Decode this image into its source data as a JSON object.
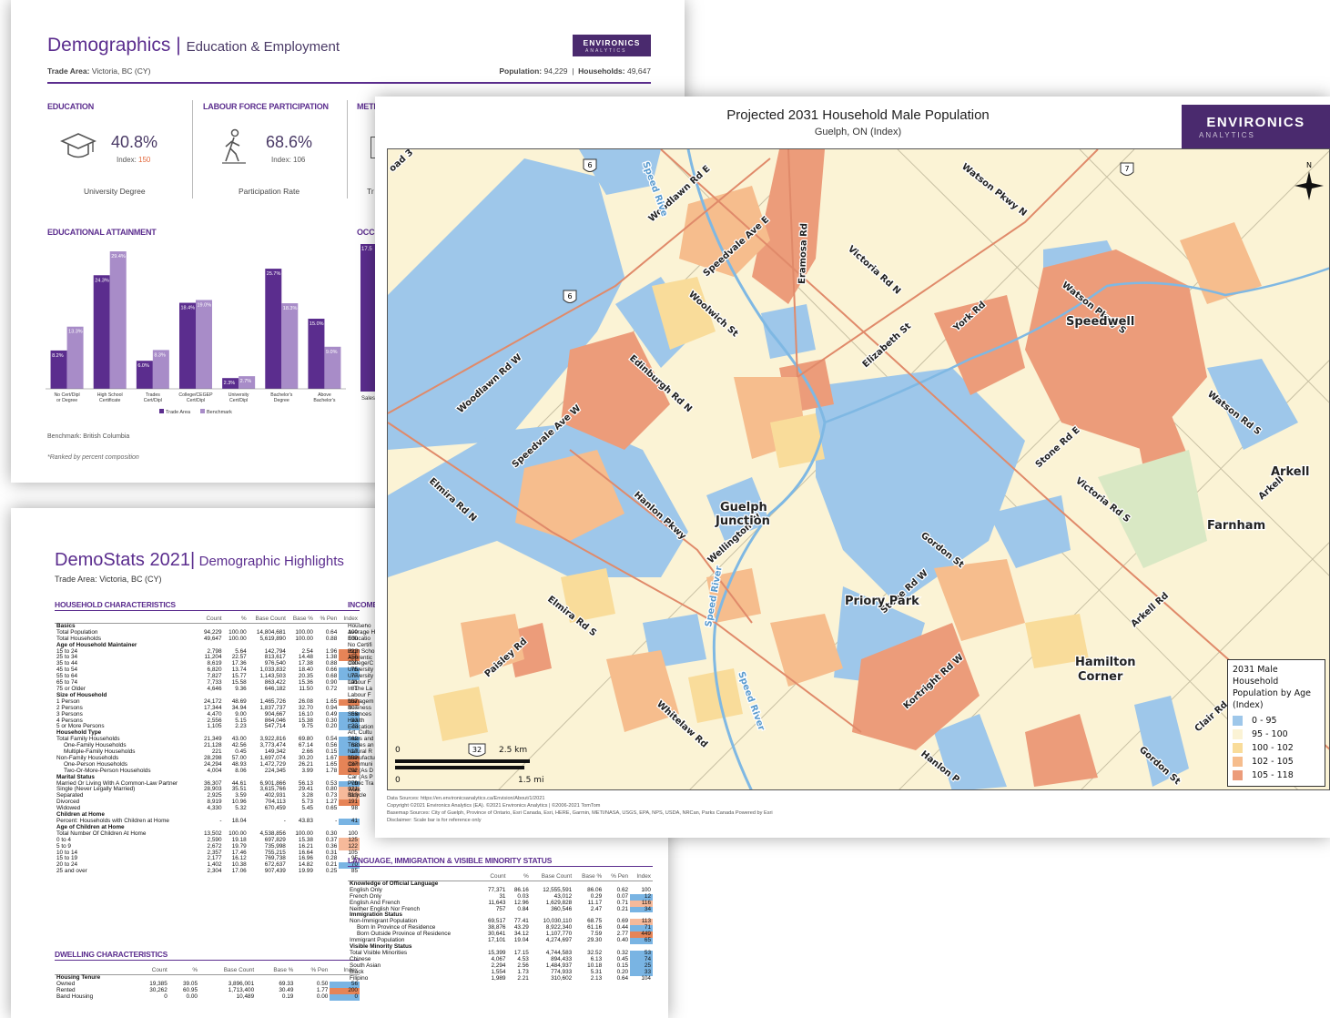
{
  "demographics": {
    "title_main": "Demographics",
    "title_sep": "|",
    "title_sub": "Education & Employment",
    "logo": {
      "line1": "ENVIRONICS",
      "line2": "ANALYTICS"
    },
    "trade_area_label": "Trade Area:",
    "trade_area_value": "Victoria, BC (CY)",
    "population_label": "Population:",
    "population_value": "94,229",
    "households_label": "Households:",
    "households_value": "49,647",
    "education": {
      "heading": "EDUCATION",
      "pct": "40.8%",
      "index_label": "Index:",
      "index_value": "150",
      "caption": "University Degree"
    },
    "labour": {
      "heading": "LABOUR FORCE PARTICIPATION",
      "pct": "68.6%",
      "index_label": "Index:",
      "index_value": "106",
      "caption": "Participation Rate"
    },
    "third_heading": "METI",
    "third_caption": "Tr",
    "attainment_heading": "EDUCATIONAL ATTAINMENT",
    "occ_heading": "OCC",
    "occ_value": "17.5",
    "occ_cat": "Sales",
    "benchmark": "Benchmark: British Columbia",
    "ranked": "*Ranked by percent composition",
    "legend_trade": "Trade Area",
    "legend_bench": "Benchmark",
    "colors": {
      "trade": "#5b2d8e",
      "bench": "#a88cc8"
    }
  },
  "chart_data": {
    "type": "bar",
    "title": "EDUCATIONAL ATTAINMENT",
    "categories": [
      "No Cert/Dipl or Degree",
      "High School Certificate",
      "Trades Cert/Dipl",
      "College/CEGEP Cert/Dipl",
      "University Cert/Dipl",
      "Bachelor's Degree",
      "Above Bachelor's"
    ],
    "series": [
      {
        "name": "Trade Area",
        "values": [
          8.2,
          24.3,
          6.0,
          18.4,
          2.3,
          25.7,
          15.0
        ],
        "labels": [
          "8.2%",
          "24.3%",
          "6.0%",
          "18.4%",
          "2.3%",
          "25.7%",
          "15.0%"
        ]
      },
      {
        "name": "Benchmark",
        "values": [
          13.3,
          29.4,
          8.3,
          19.0,
          2.7,
          18.3,
          9.0
        ],
        "labels": [
          "13.3%",
          "29.4%",
          "8.3%",
          "19.0%",
          "2.7%",
          "18.3%",
          "9.0%"
        ]
      }
    ],
    "ylim": [
      0,
      30
    ],
    "legend": "bottom",
    "grid": false
  },
  "demostats": {
    "title_main": "DemoStats 2021|",
    "title_sub": "Demographic Highlights",
    "trade_area": "Trade Area: Victoria, BC (CY)",
    "household_heading": "HOUSEHOLD CHARACTERISTICS",
    "income_heading": "INCOME",
    "dwelling_heading": "DWELLING CHARACTERISTICS",
    "language_heading": "LANGUAGE, IMMIGRATION & VISIBLE MINORITY STATUS",
    "columns": [
      "",
      "Count",
      "%",
      "Base Count",
      "Base %",
      "% Pen",
      "Index"
    ],
    "household_rows": [
      [
        "Basics",
        "",
        "",
        "",
        "",
        "",
        "",
        "g"
      ],
      [
        "Total Population",
        "94,229",
        "100.00",
        "14,804,681",
        "100.00",
        "0.64",
        "100",
        ""
      ],
      [
        "Total Households",
        "49,647",
        "100.00",
        "5,619,890",
        "100.00",
        "0.88",
        "100",
        ""
      ],
      [
        "Age of Household Maintainer",
        "",
        "",
        "",
        "",
        "",
        "",
        "g"
      ],
      [
        "15 to 24",
        "2,798",
        "5.64",
        "142,794",
        "2.54",
        "1.96",
        "222",
        "h"
      ],
      [
        "25 to 34",
        "11,204",
        "22.57",
        "813,617",
        "14.48",
        "1.38",
        "156",
        "h"
      ],
      [
        "35 to 44",
        "8,619",
        "17.36",
        "976,540",
        "17.38",
        "0.88",
        "100",
        ""
      ],
      [
        "45 to 54",
        "6,820",
        "13.74",
        "1,033,832",
        "18.40",
        "0.66",
        "75",
        "l"
      ],
      [
        "55 to 64",
        "7,827",
        "15.77",
        "1,143,503",
        "20.35",
        "0.68",
        "77",
        "l"
      ],
      [
        "65 to 74",
        "7,733",
        "15.58",
        "863,422",
        "15.36",
        "0.90",
        "101",
        ""
      ],
      [
        "75 or Older",
        "4,646",
        "9.36",
        "646,182",
        "11.50",
        "0.72",
        "81",
        ""
      ],
      [
        "Size of Household",
        "",
        "",
        "",
        "",
        "",
        "",
        "g"
      ],
      [
        "1 Person",
        "24,172",
        "48.69",
        "1,465,726",
        "26.08",
        "1.65",
        "187",
        "h"
      ],
      [
        "2 Persons",
        "17,344",
        "34.94",
        "1,837,737",
        "32.70",
        "0.94",
        "107",
        ""
      ],
      [
        "3 Persons",
        "4,470",
        "9.00",
        "904,667",
        "16.10",
        "0.49",
        "56",
        "l"
      ],
      [
        "4 Persons",
        "2,556",
        "5.15",
        "864,046",
        "15.38",
        "0.30",
        "33",
        "l"
      ],
      [
        "5 or More Persons",
        "1,105",
        "2.23",
        "547,714",
        "9.75",
        "0.20",
        "23",
        "l"
      ],
      [
        "Household Type",
        "",
        "",
        "",
        "",
        "",
        "",
        "g"
      ],
      [
        "Total Family Households",
        "21,349",
        "43.00",
        "3,922,816",
        "69.80",
        "0.54",
        "62",
        "l"
      ],
      [
        "One-Family Households",
        "21,128",
        "42.56",
        "3,773,474",
        "67.14",
        "0.56",
        "63",
        "l"
      ],
      [
        "Multiple-Family Households",
        "221",
        "0.45",
        "149,342",
        "2.66",
        "0.15",
        "17",
        "l"
      ],
      [
        "Non-Family Households",
        "28,298",
        "57.00",
        "1,697,074",
        "30.20",
        "1.67",
        "189",
        "h"
      ],
      [
        "One-Person Households",
        "24,294",
        "48.93",
        "1,472,729",
        "26.21",
        "1.65",
        "187",
        "h"
      ],
      [
        "Two-Or-More-Person Households",
        "4,004",
        "8.06",
        "224,345",
        "3.99",
        "1.78",
        "202",
        "h"
      ],
      [
        "Marital Status",
        "",
        "",
        "",
        "",
        "",
        "",
        "g"
      ],
      [
        "Married Or Living With A Common-Law Partner",
        "36,307",
        "44.61",
        "6,901,866",
        "56.13",
        "0.53",
        "79",
        "l"
      ],
      [
        "Single (Never Legally Married)",
        "28,903",
        "35.51",
        "3,615,766",
        "29.41",
        "0.80",
        "121",
        "m"
      ],
      [
        "Separated",
        "2,925",
        "3.59",
        "402,931",
        "3.28",
        "0.73",
        "110",
        "m"
      ],
      [
        "Divorced",
        "8,919",
        "10.96",
        "704,113",
        "5.73",
        "1.27",
        "191",
        "h"
      ],
      [
        "Widowed",
        "4,330",
        "5.32",
        "670,459",
        "5.45",
        "0.65",
        "98",
        ""
      ],
      [
        "Children at Home",
        "",
        "",
        "",
        "",
        "",
        "",
        "g"
      ],
      [
        "Percent: Households with Children at Home",
        "-",
        "18.04",
        "-",
        "43.83",
        "-",
        "41",
        "l"
      ],
      [
        "Age of Children at Home",
        "",
        "",
        "",
        "",
        "",
        "",
        "g"
      ],
      [
        "Total Number Of Children At Home",
        "13,502",
        "100.00",
        "4,538,856",
        "100.00",
        "0.30",
        "100",
        ""
      ],
      [
        "0 to 4",
        "2,590",
        "19.18",
        "697,829",
        "15.38",
        "0.37",
        "125",
        "m"
      ],
      [
        "5 to 9",
        "2,672",
        "19.79",
        "735,998",
        "16.21",
        "0.36",
        "122",
        "m"
      ],
      [
        "10 to 14",
        "2,357",
        "17.46",
        "755,215",
        "16.64",
        "0.31",
        "105",
        ""
      ],
      [
        "15 to 19",
        "2,177",
        "16.12",
        "769,738",
        "16.96",
        "0.28",
        "95",
        ""
      ],
      [
        "20 to 24",
        "1,402",
        "10.38",
        "672,637",
        "14.82",
        "0.21",
        "70",
        "l"
      ],
      [
        "25 and over",
        "2,304",
        "17.06",
        "907,439",
        "19.99",
        "0.25",
        "85",
        ""
      ]
    ],
    "income_rows": [
      "Househo",
      "Average H",
      "Educatio",
      "No Certifi",
      "High Scho",
      "Apprentic",
      "College/C",
      "University",
      "University",
      "Labour F",
      "In The La",
      "Labour F",
      "Managem",
      "Business",
      "Sciences",
      "Health",
      "Education",
      "Art, Cultu",
      "Sales and",
      "Trades an",
      "Natural R",
      "Manufactu",
      "Communi",
      "Car (As D",
      "Car (As P",
      "Public Tra",
      "Walk",
      "Bicycle"
    ],
    "dwelling_rows": [
      [
        "Housing Tenure",
        "",
        "",
        "",
        "",
        "",
        "",
        "g"
      ],
      [
        "Owned",
        "19,385",
        "39.05",
        "3,896,001",
        "69.33",
        "0.50",
        "56",
        "l"
      ],
      [
        "Rented",
        "30,262",
        "60.95",
        "1,713,400",
        "30.49",
        "1.77",
        "200",
        "h"
      ],
      [
        "Band Housing",
        "0",
        "0.00",
        "10,489",
        "0.19",
        "0.00",
        "0",
        "l"
      ]
    ],
    "language_rows": [
      [
        "Knowledge of Official Language",
        "",
        "",
        "",
        "",
        "",
        "",
        "g"
      ],
      [
        "English Only",
        "77,371",
        "86.16",
        "12,555,591",
        "86.06",
        "0.62",
        "100",
        ""
      ],
      [
        "French Only",
        "31",
        "0.03",
        "43,012",
        "0.29",
        "0.07",
        "12",
        "l"
      ],
      [
        "English And French",
        "11,643",
        "12.96",
        "1,629,828",
        "11.17",
        "0.71",
        "116",
        "m"
      ],
      [
        "Neither English Nor French",
        "757",
        "0.84",
        "360,546",
        "2.47",
        "0.21",
        "34",
        "l"
      ],
      [
        "Immigration Status",
        "",
        "",
        "",
        "",
        "",
        "",
        "g"
      ],
      [
        "Non-Immigrant Population",
        "69,517",
        "77.41",
        "10,030,110",
        "68.75",
        "0.69",
        "113",
        "m"
      ],
      [
        "Born In Province of Residence",
        "38,876",
        "43.29",
        "8,922,340",
        "61.16",
        "0.44",
        "71",
        "l"
      ],
      [
        "Born Outside Province of Residence",
        "30,641",
        "34.12",
        "1,107,770",
        "7.59",
        "2.77",
        "449",
        "h"
      ],
      [
        "Immigrant Population",
        "17,101",
        "19.04",
        "4,274,697",
        "29.30",
        "0.40",
        "65",
        "l"
      ],
      [
        "Visible Minority Status",
        "",
        "",
        "",
        "",
        "",
        "",
        "g"
      ],
      [
        "Total Visible Minorities",
        "15,399",
        "17.15",
        "4,744,583",
        "32.52",
        "0.32",
        "53",
        "l"
      ],
      [
        "Chinese",
        "4,067",
        "4.53",
        "894,433",
        "6.13",
        "0.45",
        "74",
        "l"
      ],
      [
        "South Asian",
        "2,294",
        "2.56",
        "1,484,937",
        "10.18",
        "0.15",
        "25",
        "l"
      ],
      [
        "Black",
        "1,554",
        "1.73",
        "774,933",
        "5.31",
        "0.20",
        "33",
        "l"
      ],
      [
        "Filipino",
        "1,989",
        "2.21",
        "310,602",
        "2.13",
        "0.64",
        "104",
        ""
      ]
    ]
  },
  "map": {
    "title": "Projected 2031 Household Male Population",
    "subtitle": "Guelph, ON (Index)",
    "logo": {
      "line1": "ENVIRONICS",
      "line2": "ANALYTICS"
    },
    "north": "N",
    "place_labels": [
      "Guelph",
      "Junction",
      "Speedwell",
      "Priory Park",
      "Hamilton",
      "Corner",
      "Farnham",
      "Arkell"
    ],
    "road_labels": [
      "Woodlawn Rd E",
      "Speedvale Ave E",
      "Eramosa Rd",
      "Victoria Rd N",
      "Watson Pkwy N",
      "Watson Pkwy S",
      "Woolwich St",
      "Elizabeth St",
      "York Rd",
      "Woodlawn Rd W",
      "Edinburgh Rd N",
      "Speedvale Ave W",
      "Elmira Rd N",
      "Hanlon Pkwy",
      "Wellington W",
      "Stone Rd E",
      "Victoria Rd S",
      "Watson Rd S",
      "Arkell Rd",
      "Gordon St",
      "Stone Rd W",
      "Elmira Rd S",
      "Paisley Rd",
      "Whitelaw Rd",
      "Kortright Rd W",
      "Clair Rd",
      "Speed River",
      "Speed River",
      "Speed Rive",
      "Hanlon P",
      "Gordon St",
      "Arkell",
      "oad 3",
      "Speed River"
    ],
    "shields": [
      "6",
      "6",
      "7",
      "32"
    ],
    "scale": {
      "zero_km": "0",
      "km": "2.5 km",
      "zero_mi": "0",
      "mi": "1.5 mi"
    },
    "legend": {
      "title": "2031 Male Household Population by Age (Index)",
      "title_lines": [
        "2031 Male",
        "Household",
        "Population by Age",
        "(Index)"
      ],
      "items": [
        {
          "label": "0 - 95",
          "color": "#9ec7ea"
        },
        {
          "label": "95 - 100",
          "color": "#fbf3d5"
        },
        {
          "label": "100 - 102",
          "color": "#f9dc9a"
        },
        {
          "label": "102 - 105",
          "color": "#f6bd8d"
        },
        {
          "label": "105 - 118",
          "color": "#ec9c7a"
        }
      ]
    },
    "sources": [
      "Data Sources: https://en.environicsanalytics.ca/Envision/About/1/2021",
      "Copyright ©2021 Environics Analytics (EA). ©2021 Environics Analytics | ©2006-2021 TomTom",
      "Basemap Sources: City of Guelph, Province of Ontario, Esri Canada, Esri, HERE, Garmin, METI/NASA, USGS, EPA, NPS, USDA, NRCan, Parks Canada  Powered by Esri",
      "Disclaimer: Scale bar is for reference only"
    ]
  }
}
